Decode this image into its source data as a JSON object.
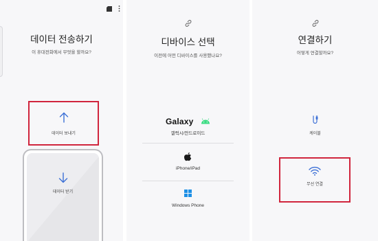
{
  "panel1": {
    "title": "데이터 전송하기",
    "subtitle": "이 휴대전화에서 무엇을 할까요?",
    "send_label": "데이터 보내기",
    "receive_label": "데이터 받기",
    "icons": [
      "sd-card-icon",
      "more-options-icon",
      "arrow-up-icon",
      "arrow-down-icon"
    ]
  },
  "panel2": {
    "title": "디바이스 선택",
    "subtitle": "이전에 어떤 디바이스를 사용했나요?",
    "galaxy_brand": "Galaxy",
    "galaxy_label": "갤럭시/안드로이드",
    "iphone_label": "iPhone/iPad",
    "windows_label": "Windows Phone",
    "icons": [
      "link-icon",
      "android-icon",
      "apple-icon",
      "windows-icon"
    ]
  },
  "panel3": {
    "title": "연결하기",
    "subtitle": "어떻게 연결할까요?",
    "cable_label": "케이블",
    "wireless_label": "무선 연결",
    "icons": [
      "link-icon",
      "cable-icon",
      "wifi-icon"
    ]
  },
  "colors": {
    "accent_blue": "#3b6fd6",
    "highlight_red": "#d0243c",
    "android_green": "#3ddc84",
    "windows_blue": "#1e90e6"
  }
}
